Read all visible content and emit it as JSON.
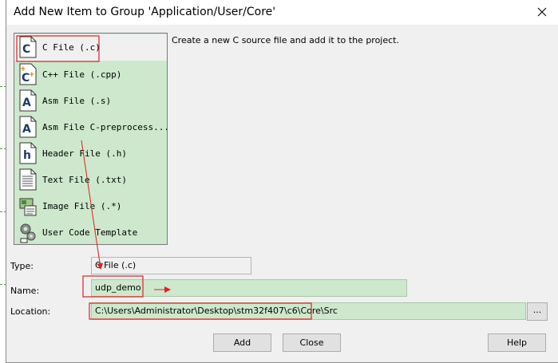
{
  "window": {
    "title": "Add New Item to Group 'Application/User/Core'"
  },
  "file_types": [
    {
      "label": "C File (.c)",
      "icon": "c-file-icon",
      "selected": true
    },
    {
      "label": "C++ File (.cpp)",
      "icon": "cpp-file-icon",
      "selected": false
    },
    {
      "label": "Asm File (.s)",
      "icon": "asm-file-icon",
      "selected": false
    },
    {
      "label": "Asm File C-preprocess...",
      "icon": "asm-preprocess-file-icon",
      "selected": false
    },
    {
      "label": "Header File (.h)",
      "icon": "header-file-icon",
      "selected": false
    },
    {
      "label": "Text File (.txt)",
      "icon": "text-file-icon",
      "selected": false
    },
    {
      "label": "Image File (.*)",
      "icon": "image-file-icon",
      "selected": false
    },
    {
      "label": "User Code Template",
      "icon": "user-template-icon",
      "selected": false
    }
  ],
  "description": "Create a new C source file and add it to the project.",
  "form": {
    "type_label": "Type:",
    "type_value": "C File (.c)",
    "name_label": "Name:",
    "name_value": "udp_demo",
    "location_label": "Location:",
    "location_value": "C:\\Users\\Administrator\\Desktop\\stm32f407\\c6\\Core\\Src",
    "browse_label": "..."
  },
  "buttons": {
    "add": "Add",
    "close": "Close",
    "help": "Help"
  },
  "colors": {
    "list_bg": "#cde8cd",
    "annotation_red": "#e02020"
  }
}
